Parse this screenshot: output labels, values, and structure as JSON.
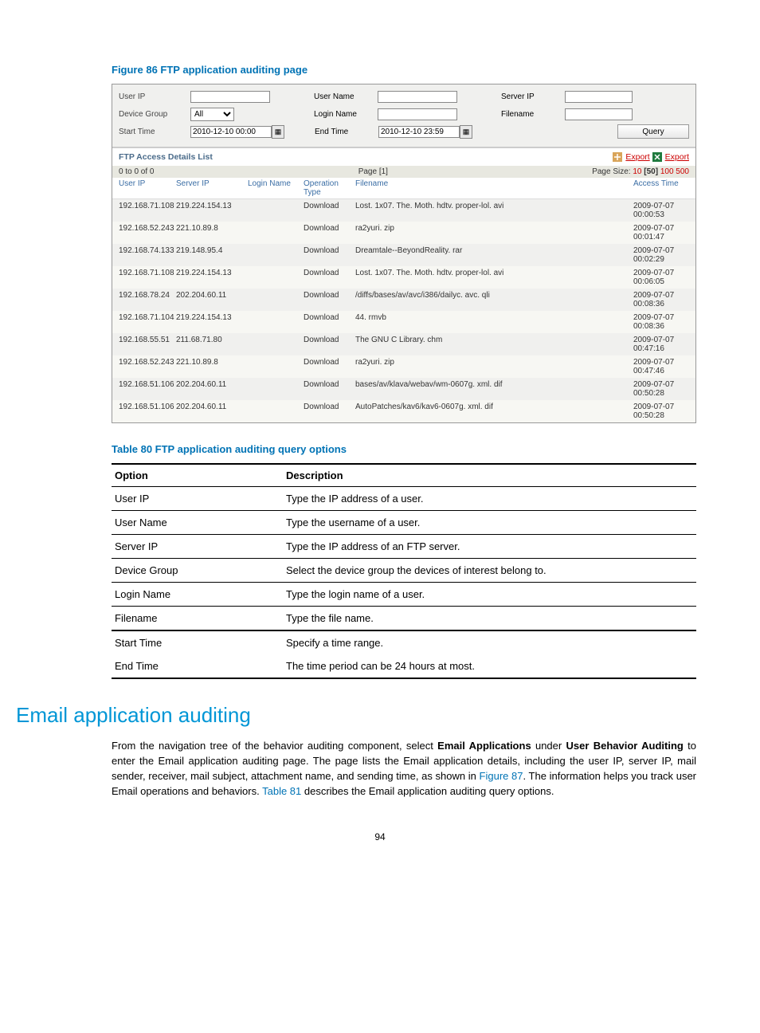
{
  "figure_title": "Figure 86 FTP application auditing page",
  "filters": {
    "user_ip_label": "User IP",
    "user_name_label": "User Name",
    "server_ip_label": "Server IP",
    "device_group_label": "Device Group",
    "device_group_value": "All",
    "login_name_label": "Login Name",
    "filename_label": "Filename",
    "start_time_label": "Start Time",
    "start_time_value": "2010-12-10 00:00",
    "end_time_label": "End Time",
    "end_time_value": "2010-12-10 23:59",
    "query_btn": "Query"
  },
  "list": {
    "title": "FTP Access Details List",
    "export1": "Export",
    "export2": "Export",
    "range": "0 to 0 of 0",
    "page": "Page [1]",
    "pagesize_label": "Page Size: ",
    "ps_10": "10",
    "ps_50": "[50]",
    "ps_100": "100",
    "ps_500": "500",
    "hdr": {
      "userip": "User IP",
      "serverip": "Server IP",
      "login": "Login Name",
      "op": "Operation Type",
      "file": "Filename",
      "time": "Access Time"
    },
    "rows": [
      {
        "userip": "192.168.71.108",
        "serverip": "219.224.154.13",
        "login": "",
        "op": "Download",
        "file": "Lost. 1x07. The. Moth. hdtv. proper-lol. avi",
        "time": "2009-07-07 00:00:53"
      },
      {
        "userip": "192.168.52.243",
        "serverip": "221.10.89.8",
        "login": "",
        "op": "Download",
        "file": "ra2yuri. zip",
        "time": "2009-07-07 00:01:47"
      },
      {
        "userip": "192.168.74.133",
        "serverip": "219.148.95.4",
        "login": "",
        "op": "Download",
        "file": "Dreamtale--BeyondReality. rar",
        "time": "2009-07-07 00:02:29"
      },
      {
        "userip": "192.168.71.108",
        "serverip": "219.224.154.13",
        "login": "",
        "op": "Download",
        "file": "Lost. 1x07. The. Moth. hdtv. proper-lol. avi",
        "time": "2009-07-07 00:06:05"
      },
      {
        "userip": "192.168.78.24",
        "serverip": "202.204.60.11",
        "login": "",
        "op": "Download",
        "file": "/diffs/bases/av/avc/i386/dailyc. avc. qli",
        "time": "2009-07-07 00:08:36"
      },
      {
        "userip": "192.168.71.104",
        "serverip": "219.224.154.13",
        "login": "",
        "op": "Download",
        "file": "44. rmvb",
        "time": "2009-07-07 00:08:36"
      },
      {
        "userip": "192.168.55.51",
        "serverip": "211.68.71.80",
        "login": "",
        "op": "Download",
        "file": "The GNU C Library. chm",
        "time": "2009-07-07 00:47:16"
      },
      {
        "userip": "192.168.52.243",
        "serverip": "221.10.89.8",
        "login": "",
        "op": "Download",
        "file": "ra2yuri. zip",
        "time": "2009-07-07 00:47:46"
      },
      {
        "userip": "192.168.51.106",
        "serverip": "202.204.60.11",
        "login": "",
        "op": "Download",
        "file": "bases/av/klava/webav/wm-0607g. xml. dif",
        "time": "2009-07-07 00:50:28"
      },
      {
        "userip": "192.168.51.106",
        "serverip": "202.204.60.11",
        "login": "",
        "op": "Download",
        "file": "AutoPatches/kav6/kav6-0607g. xml. dif",
        "time": "2009-07-07 00:50:28"
      }
    ]
  },
  "table80": {
    "title": "Table 80 FTP application auditing query options",
    "hdr_option": "Option",
    "hdr_desc": "Description",
    "rows": [
      {
        "opt": "User IP",
        "desc": "Type the IP address of a user."
      },
      {
        "opt": "User Name",
        "desc": "Type the username of a user."
      },
      {
        "opt": "Server IP",
        "desc": "Type the IP address of an FTP server."
      },
      {
        "opt": "Device Group",
        "desc": "Select the device group the devices of interest belong to."
      },
      {
        "opt": "Login Name",
        "desc": "Type the login name of a user."
      },
      {
        "opt": "Filename",
        "desc": "Type the file name."
      }
    ],
    "start_opt": "Start Time",
    "start_desc": "Specify a time range.",
    "end_opt": "End Time",
    "end_desc": "The time period can be 24 hours at most."
  },
  "email": {
    "heading": "Email application auditing",
    "p1a": "From the navigation tree of the behavior auditing component, select ",
    "p1b": "Email Applications",
    "p1c": " under ",
    "p1d": "User Behavior Auditing",
    "p1e": " to enter the Email application auditing page. The page lists the Email application details, including the user IP, server IP, mail sender, receiver, mail subject, attachment name, and sending time, as shown in ",
    "p1f": "Figure 87",
    "p1g": ". The information helps you track user Email operations and behaviors. ",
    "p1h": "Table 81",
    "p1i": " describes the Email application auditing query options."
  },
  "pagenum": "94"
}
